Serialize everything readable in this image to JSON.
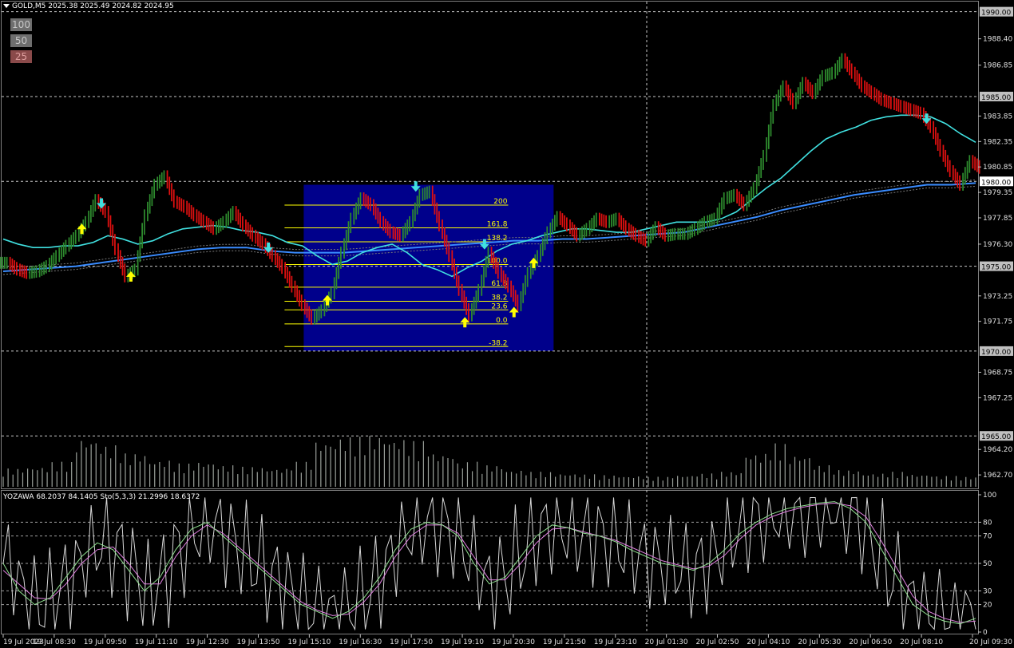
{
  "header": {
    "symbol_info": "GOLD,M5  2025.38 2025.49 2024.82 2024.95"
  },
  "buttons": [
    {
      "label": "100"
    },
    {
      "label": "50"
    },
    {
      "label": "25"
    }
  ],
  "price_axis": {
    "labels": [
      "1990.00",
      "1988.40",
      "1986.85",
      "1985.00",
      "1983.85",
      "1982.35",
      "1980.85",
      "1980.00",
      "1979.35",
      "1977.85",
      "1976.30",
      "1975.00",
      "1973.25",
      "1971.75",
      "1970.00",
      "1968.75",
      "1967.25",
      "1965.00",
      "1964.20",
      "1962.70"
    ],
    "highlighted": [
      "1990.00",
      "1985.00",
      "1980.00",
      "1975.00",
      "1970.00",
      "1965.00"
    ],
    "current_price": "1980.00"
  },
  "time_axis": {
    "labels": [
      "19 Jul 2023",
      "19 Jul 08:30",
      "19 Jul 09:50",
      "19 Jul 11:10",
      "19 Jul 12:30",
      "19 Jul 13:50",
      "19 Jul 15:10",
      "19 Jul 16:30",
      "19 Jul 17:50",
      "19 Jul 19:10",
      "19 Jul 20:30",
      "19 Jul 21:50",
      "19 Jul 23:10",
      "20 Jul 01:30",
      "20 Jul 02:50",
      "20 Jul 04:10",
      "20 Jul 05:30",
      "20 Jul 06:50",
      "20 Jul 08:10",
      "20 Jul 09:30"
    ]
  },
  "fibonacci": {
    "levels": [
      "200",
      "161.8",
      "138.2",
      "100.0",
      "61.8",
      "38.2",
      "23.6",
      "0.0",
      "-38.2"
    ]
  },
  "oscillator": {
    "title": "YOZAWA 68.2037 84.1405  Sto(5,3,3) 21.2996 18.6372",
    "levels": [
      "100",
      "80",
      "70",
      "50",
      "30",
      "20",
      "0"
    ]
  },
  "colors": {
    "bull": "#2e8b2e",
    "bear": "#e01010",
    "fast_ma": "#40e0e0",
    "slow_ma": "#3a8cff",
    "fib_box": "#00008b",
    "fib_line": "#ffff00",
    "signal_up": "#ffff00",
    "signal_down": "#40e0e0"
  },
  "chart_data": {
    "type": "line",
    "ylim": [
      1962.0,
      1990.5
    ],
    "price_series": [
      1975.2,
      1974.8,
      1974.6,
      1974.7,
      1975.0,
      1975.6,
      1976.2,
      1976.8,
      1977.6,
      1978.9,
      1978.2,
      1976.0,
      1974.4,
      1974.8,
      1978.0,
      1979.8,
      1980.3,
      1978.8,
      1978.5,
      1978.0,
      1977.6,
      1977.2,
      1977.6,
      1978.2,
      1977.4,
      1976.8,
      1976.3,
      1975.6,
      1974.9,
      1973.8,
      1972.7,
      1971.9,
      1972.4,
      1973.4,
      1975.8,
      1977.8,
      1979.0,
      1978.6,
      1977.6,
      1977.0,
      1976.8,
      1977.6,
      1979.2,
      1979.4,
      1977.4,
      1975.6,
      1973.6,
      1972.1,
      1973.6,
      1975.8,
      1974.6,
      1973.8,
      1972.7,
      1974.6,
      1975.6,
      1977.0,
      1977.9,
      1977.4,
      1976.8,
      1977.2,
      1977.8,
      1977.6,
      1977.8,
      1977.2,
      1976.8,
      1976.5,
      1977.3,
      1976.8,
      1976.9,
      1976.9,
      1977.2,
      1977.6,
      1977.8,
      1979.0,
      1979.2,
      1978.6,
      1979.6,
      1981.5,
      1984.5,
      1985.6,
      1984.6,
      1985.8,
      1985.2,
      1986.2,
      1986.4,
      1987.2,
      1986.4,
      1985.6,
      1985.2,
      1984.8,
      1984.6,
      1984.4,
      1984.2,
      1984.0,
      1983.2,
      1981.8,
      1980.6,
      1979.8,
      1981.2,
      1980.8
    ],
    "fast_ma": [
      1976.6,
      1976.3,
      1976.1,
      1976.1,
      1976.2,
      1976.2,
      1976.4,
      1976.8,
      1976.6,
      1976.3,
      1976.5,
      1976.9,
      1977.2,
      1977.3,
      1977.4,
      1977.3,
      1977.1,
      1977.0,
      1976.8,
      1976.4,
      1976.2,
      1975.6,
      1975.1,
      1975.3,
      1975.8,
      1976.1,
      1976.3,
      1975.8,
      1975.1,
      1974.8,
      1974.4,
      1974.9,
      1975.3,
      1975.9,
      1976.3,
      1976.5,
      1976.8,
      1977.0,
      1977.2,
      1977.2,
      1977.1,
      1977.0,
      1977.0,
      1977.2,
      1977.4,
      1977.6,
      1977.6,
      1977.6,
      1977.8,
      1978.2,
      1978.9,
      1979.6,
      1980.2,
      1981.0,
      1981.8,
      1982.5,
      1982.9,
      1983.2,
      1983.6,
      1983.8,
      1983.9,
      1983.9,
      1983.8,
      1983.4,
      1982.8,
      1982.3
    ],
    "slow_ma": [
      1974.7,
      1974.8,
      1974.9,
      1975.0,
      1975.2,
      1975.4,
      1975.6,
      1975.8,
      1976.0,
      1976.1,
      1976.1,
      1975.9,
      1975.8,
      1975.8,
      1975.8,
      1975.9,
      1976.0,
      1976.1,
      1976.2,
      1976.3,
      1976.4,
      1976.5,
      1976.5,
      1976.6,
      1976.6,
      1976.7,
      1976.8,
      1976.9,
      1977.0,
      1977.3,
      1977.6,
      1977.9,
      1978.3,
      1978.6,
      1978.9,
      1979.2,
      1979.4,
      1979.6,
      1979.8,
      1979.8,
      1979.9
    ],
    "signals": [
      {
        "dir": "up",
        "i": 8
      },
      {
        "dir": "down",
        "i": 10
      },
      {
        "dir": "up",
        "i": 13
      },
      {
        "dir": "down",
        "i": 27
      },
      {
        "dir": "up",
        "i": 33
      },
      {
        "dir": "down",
        "i": 42
      },
      {
        "dir": "up",
        "i": 47
      },
      {
        "dir": "down",
        "i": 49
      },
      {
        "dir": "up",
        "i": 52
      },
      {
        "dir": "up",
        "i": 54
      },
      {
        "dir": "down",
        "i": 94
      }
    ],
    "osc_ylim": [
      0,
      100
    ],
    "sto_main": [
      50,
      30,
      20,
      25,
      40,
      55,
      65,
      60,
      45,
      30,
      40,
      60,
      75,
      80,
      70,
      60,
      50,
      40,
      30,
      20,
      15,
      10,
      15,
      25,
      40,
      60,
      75,
      80,
      78,
      70,
      50,
      35,
      40,
      55,
      70,
      78,
      76,
      72,
      70,
      66,
      60,
      55,
      50,
      48,
      45,
      50,
      60,
      72,
      80,
      86,
      90,
      92,
      94,
      95,
      90,
      80,
      60,
      40,
      20,
      12,
      8,
      6,
      10
    ],
    "sto_signal": [
      45,
      35,
      25,
      24,
      35,
      50,
      60,
      62,
      50,
      35,
      35,
      55,
      70,
      78,
      72,
      62,
      52,
      42,
      32,
      22,
      16,
      12,
      13,
      22,
      35,
      55,
      70,
      78,
      78,
      72,
      55,
      38,
      38,
      50,
      65,
      75,
      76,
      73,
      70,
      67,
      62,
      57,
      52,
      49,
      46,
      48,
      56,
      68,
      78,
      84,
      88,
      91,
      93,
      94,
      92,
      84,
      66,
      46,
      26,
      15,
      10,
      7,
      8
    ],
    "volume": [
      22,
      24,
      30,
      58,
      50,
      40,
      32,
      28,
      30,
      26,
      24,
      22,
      30,
      55,
      60,
      62,
      58,
      55,
      40,
      30,
      26,
      20,
      18,
      16,
      15,
      14,
      13,
      12,
      14,
      16,
      18,
      40,
      52,
      38,
      26,
      20,
      16,
      18,
      15,
      13,
      12
    ]
  }
}
